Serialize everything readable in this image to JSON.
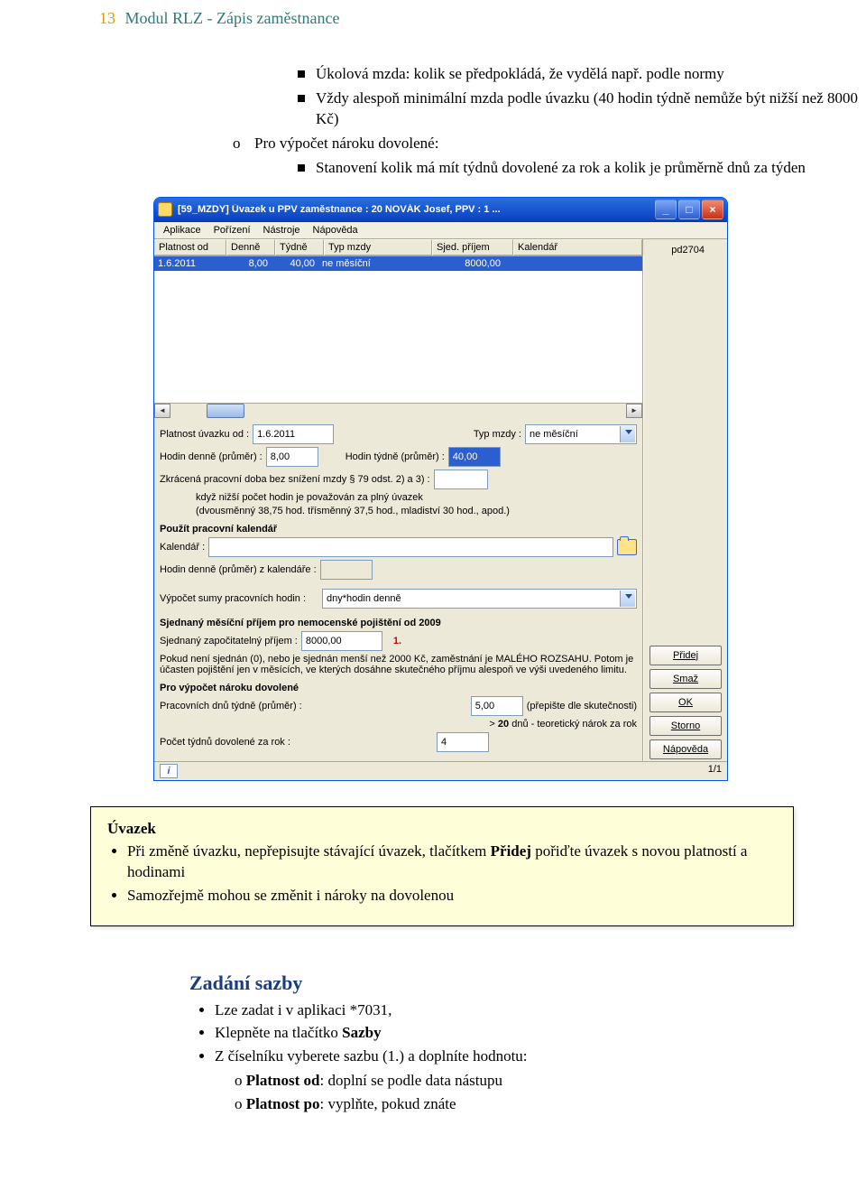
{
  "header": {
    "page_num": "13",
    "title": "Modul RLZ - Zápis zaměstnance"
  },
  "top_list": {
    "b1": "Úkolová mzda: kolik se předpokládá, že vydělá např. podle normy",
    "b2": "Vždy alespoň minimální mzda podle úvazku (40 hodin týdně nemůže být nižší než 8000 Kč)",
    "circ_label": "Pro výpočet nároku dovolené:",
    "b3": "Stanovení kolik má mít týdnů dovolené za rok a kolik je průměrně dnů za týden"
  },
  "win": {
    "title": "[59_MZDY] Úvazek u PPV zaměstnance : 20 NOVÁK Josef, PPV : 1 ...",
    "menubar": [
      "Aplikace",
      "Pořízení",
      "Nástroje",
      "Nápověda"
    ],
    "right_info": "pd2704",
    "grid_headers": {
      "pod": "Platnost od",
      "den": "Denně",
      "tyd": "Týdně",
      "typ": "Typ mzdy",
      "spr": "Sjed. příjem",
      "kal": "Kalendář"
    },
    "grid_row": {
      "pod": "1.6.2011",
      "den": "8,00",
      "tyd": "40,00",
      "typ": "ne měsíční",
      "spr": "8000,00",
      "kal": ""
    },
    "form": {
      "lab_platod": "Platnost úvazku od :",
      "val_platod": "1.6.2011",
      "lab_typ": "Typ mzdy :",
      "val_typ": "ne měsíční",
      "lab_den": "Hodin denně (průměr) :",
      "val_den": "8,00",
      "lab_tyd": "Hodin týdně (průměr) :",
      "val_tyd": "40,00",
      "zkrac": "Zkrácená pracovní doba bez snížení mzdy § 79 odst. 2) a 3) :",
      "zkrac_note1": "když nižší počet hodin je považován za plný úvazek",
      "zkrac_note2": "(dvousměnný 38,75 hod. třísměnný 37,5 hod., mladiství 30 hod., apod.)",
      "sec_kal": "Použít pracovní kalendář",
      "lab_kal": "Kalendář :",
      "lab_hodkal": "Hodin denně (průměr) z kalendáře :",
      "lab_vypocet": "Výpočet sumy pracovních hodin :",
      "val_vypocet": "dny*hodin denně",
      "sec_sjed": "Sjednaný měsíční příjem pro nemocenské pojištění od 2009",
      "lab_sjed": "Sjednaný započitatelný příjem :",
      "val_sjed": "8000,00",
      "red": "1.",
      "sjed_note": "Pokud není sjednán (0), nebo je sjednán menší než 2000 Kč, zaměstnání je MALÉHO ROZSAHU. Potom je účasten pojištění jen v měsících, ve kterých dosáhne skutečného příjmu alespoň ve výši uvedeného limitu.",
      "sec_dov": "Pro výpočet nároku dovolené",
      "lab_pracdnu": "Pracovních dnů týdně (průměr) :",
      "val_pracdnu": "5,00",
      "pracdnu_hint": "(přepište dle skutečnosti)",
      "lab_narok": "> ",
      "lab_narok_val": "20",
      "lab_narok_txt": " dnů - teoretický nárok za rok",
      "lab_pocet": "Počet týdnů dovolené za rok :",
      "val_pocet": "4"
    },
    "buttons": {
      "pridej": "Přidej",
      "smaz": "Smaž",
      "ok": "OK",
      "storno": "Storno",
      "napoveda": "Nápověda"
    },
    "status": {
      "i": "i",
      "right": "1/1"
    }
  },
  "notebox": {
    "title": "Úvazek",
    "b1": "Při změně úvazku, nepřepisujte stávající úvazek, tlačítkem ",
    "b1_bold": "Přidej",
    "b1_rest": " pořiďte úvazek s novou platností a hodinami",
    "b2": "Samozřejmě mohou se změnit i nároky na dovolenou"
  },
  "blue": {
    "h": "Zadání sazby",
    "b1": "Lze zadat i v aplikaci *7031,",
    "b2_pre": "Klepněte na tlačítko ",
    "b2_bold": "Sazby",
    "b3": "Z číselníku vyberete sazbu (1.) a doplníte hodnotu:",
    "o1_pre": "",
    "o1_bold": "Platnost od",
    "o1_rest": ": doplní se podle data nástupu",
    "o2_bold": "Platnost po",
    "o2_rest": ": vyplňte, pokud znáte"
  }
}
